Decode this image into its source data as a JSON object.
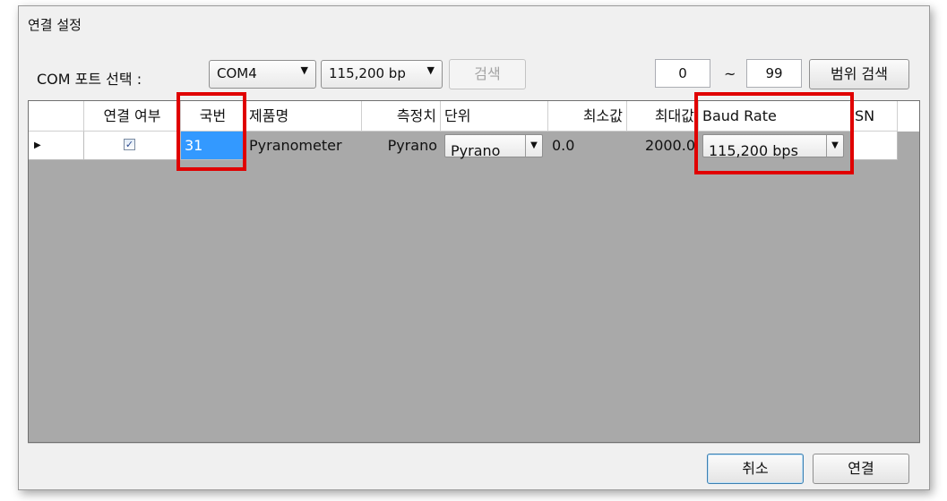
{
  "window": {
    "title": "연결 설정"
  },
  "toolbar": {
    "com_label": "COM 포트 선택 :",
    "com_value": "COM4",
    "baud_value": "115,200 bp",
    "search_label": "검색",
    "range_from": "0",
    "range_sep": "~",
    "range_to": "99",
    "range_search_label": "범위 검색"
  },
  "table": {
    "columns": [
      "연결 여부",
      "국번",
      "제품명",
      "측정치",
      "단위",
      "최소값",
      "최대값",
      "Baud Rate",
      "SN"
    ],
    "rows": [
      {
        "connected": "✓",
        "station": "31",
        "product": "Pyranometer",
        "measurement": "Pyrano",
        "unit": "Pyrano",
        "min": "0.0",
        "max": "2000.0",
        "baud": "115,200 bps",
        "sn": ""
      }
    ]
  },
  "footer": {
    "cancel_label": "취소",
    "connect_label": "연결"
  },
  "colors": {
    "highlight": "#e00000",
    "selection": "#3399ff",
    "grid_bg": "#a9a9a9"
  }
}
